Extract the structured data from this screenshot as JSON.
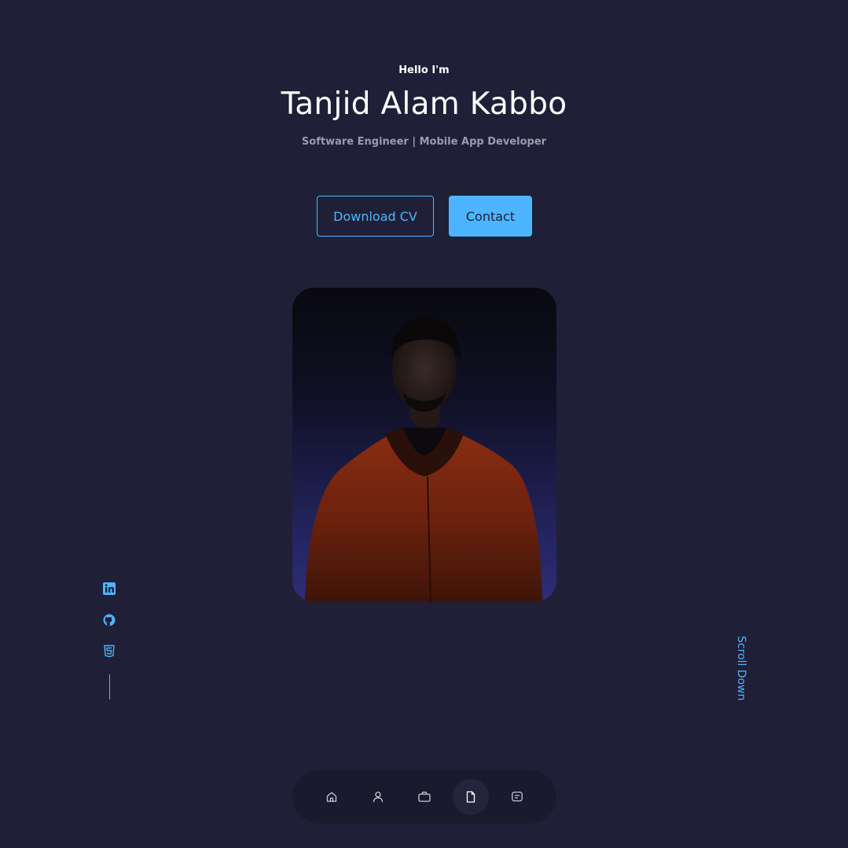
{
  "header": {
    "greeting": "Hello I'm",
    "name": "Tanjid Alam Kabbo",
    "role": "Software Engineer | Mobile App Developer"
  },
  "cta": {
    "download_cv_label": "Download CV",
    "contact_label": "Contact"
  },
  "socials": [
    {
      "icon": "linkedin-icon"
    },
    {
      "icon": "github-icon"
    },
    {
      "icon": "html5-icon"
    }
  ],
  "scroll": {
    "label": "Scroll Down"
  },
  "nav": {
    "items": [
      {
        "icon": "home-icon"
      },
      {
        "icon": "user-icon"
      },
      {
        "icon": "briefcase-icon"
      },
      {
        "icon": "file-icon",
        "active": true
      },
      {
        "icon": "message-icon"
      }
    ]
  },
  "colors": {
    "background": "#1f1f38",
    "accent": "#4db5ff",
    "nav_background": "#1a1a2e",
    "text_muted": "#9b9bad"
  }
}
